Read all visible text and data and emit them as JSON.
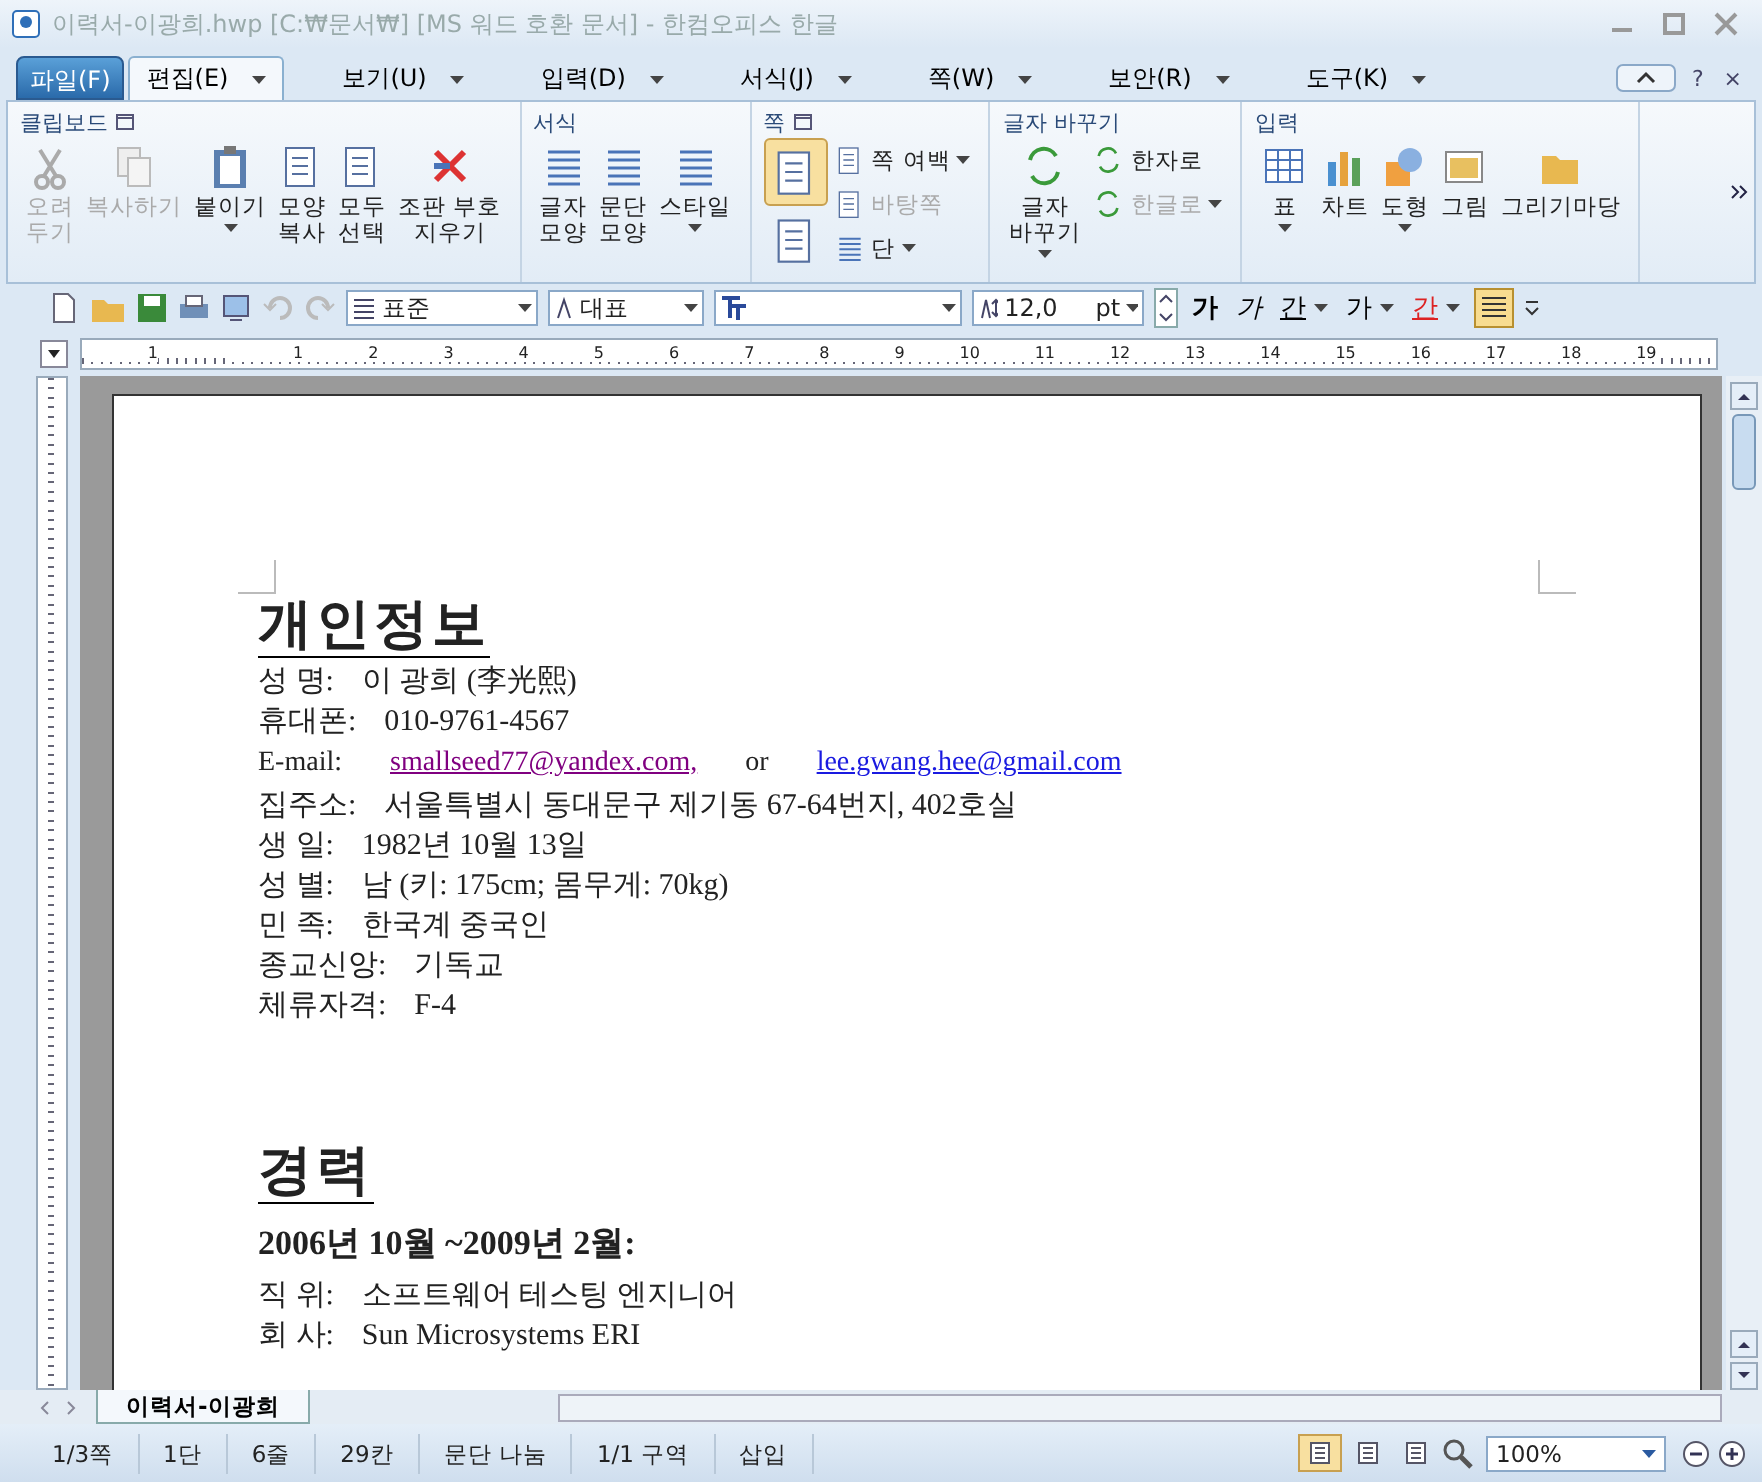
{
  "window": {
    "title": "이력서-이광희.hwp [C:₩문서₩] [MS 워드 호환 문서] - 한컴오피스 한글"
  },
  "menu_tabs": [
    {
      "label": "파일(F)",
      "kind": "file",
      "selected": false
    },
    {
      "label": "편집(E)",
      "kind": "tab",
      "selected": true,
      "dropdown": true
    },
    {
      "label": "보기(U)",
      "kind": "tab",
      "selected": false,
      "dropdown": true
    },
    {
      "label": "입력(D)",
      "kind": "tab",
      "selected": false,
      "dropdown": true
    },
    {
      "label": "서식(J)",
      "kind": "tab",
      "selected": false,
      "dropdown": true
    },
    {
      "label": "쪽(W)",
      "kind": "tab",
      "selected": false,
      "dropdown": true
    },
    {
      "label": "보안(R)",
      "kind": "tab",
      "selected": false,
      "dropdown": true
    },
    {
      "label": "도구(K)",
      "kind": "tab",
      "selected": false,
      "dropdown": true
    }
  ],
  "help_buttons": [
    "?",
    "×"
  ],
  "ribbon": [
    {
      "title": "클립보드",
      "settings": true,
      "items": [
        {
          "kind": "large",
          "label": "오려\n두기",
          "disabled": true,
          "dropdown": false
        },
        {
          "kind": "large",
          "label": "복사하기",
          "disabled": true,
          "dropdown": false
        },
        {
          "kind": "large",
          "label": "붙이기",
          "disabled": false,
          "dropdown": true
        },
        {
          "kind": "large",
          "label": "모양\n복사",
          "disabled": false,
          "dropdown": false
        },
        {
          "kind": "large",
          "label": "모두\n선택",
          "disabled": false,
          "dropdown": false
        },
        {
          "kind": "large",
          "label": "조판 부호\n지우기",
          "disabled": false,
          "dropdown": false
        }
      ]
    },
    {
      "title": "서식",
      "items": [
        {
          "kind": "large",
          "label": "글자\n모양",
          "disabled": false,
          "dropdown": false
        },
        {
          "kind": "large",
          "label": "문단\n모양",
          "disabled": false,
          "dropdown": false
        },
        {
          "kind": "large",
          "label": "스타일",
          "disabled": false,
          "dropdown": true
        }
      ]
    },
    {
      "title": "쪽",
      "settings": true,
      "items": [
        {
          "kind": "page",
          "selected": true
        },
        {
          "kind": "page",
          "selected": false
        },
        {
          "kind": "small",
          "label": "쪽 여백",
          "disabled": false,
          "dropdown": true
        },
        {
          "kind": "small",
          "label": "바탕쪽",
          "disabled": true,
          "dropdown": false
        },
        {
          "kind": "small",
          "label": "단",
          "disabled": false,
          "dropdown": true
        }
      ]
    },
    {
      "title": "글자 바꾸기",
      "items": [
        {
          "kind": "large",
          "label": "글자\n바꾸기",
          "disabled": false,
          "dropdown": true
        },
        {
          "kind": "small",
          "label": "한자로",
          "disabled": false,
          "dropdown": false
        },
        {
          "kind": "small",
          "label": "한글로",
          "disabled": true,
          "dropdown": true
        }
      ]
    },
    {
      "title": "입력",
      "items": [
        {
          "kind": "large",
          "label": "표",
          "disabled": false,
          "dropdown": true
        },
        {
          "kind": "large",
          "label": "차트",
          "disabled": false,
          "dropdown": false
        },
        {
          "kind": "large",
          "label": "도형",
          "disabled": false,
          "dropdown": true
        },
        {
          "kind": "large",
          "label": "그림",
          "disabled": false,
          "dropdown": false
        },
        {
          "kind": "large",
          "label": "그리기마당",
          "disabled": false,
          "dropdown": false
        }
      ]
    }
  ],
  "toolbar": {
    "style": "표준",
    "language": "대표",
    "size": "12,0",
    "unit": "pt",
    "format_buttons": [
      {
        "label": "가",
        "kind": "bold",
        "dropdown": false
      },
      {
        "label": "가",
        "kind": "italic",
        "dropdown": false
      },
      {
        "label": "간",
        "kind": "underline",
        "dropdown": true
      },
      {
        "label": "가",
        "kind": "outline",
        "dropdown": true
      },
      {
        "label": "간",
        "kind": "color",
        "dropdown": true
      }
    ]
  },
  "ruler": {
    "labels": [
      "1",
      "1",
      "2",
      "3",
      "4",
      "5",
      "6",
      "7",
      "8",
      "9",
      "10",
      "11",
      "12",
      "13",
      "14",
      "15",
      "16",
      "17",
      "18",
      "19"
    ]
  },
  "document": {
    "sections": [
      {
        "heading": "개인정보",
        "lines": [
          {
            "kind": "field",
            "label": "성 명:",
            "value": "이 광희 (李光熙)"
          },
          {
            "kind": "field",
            "label": "휴대폰:",
            "value": "010-9761-4567"
          },
          {
            "kind": "email",
            "label": "E-mail:",
            "links": [
              {
                "text": "smallseed77@yandex.com,",
                "visited": true
              },
              {
                "text": "lee.gwang.hee@gmail.com",
                "visited": false
              }
            ],
            "separator": "or"
          },
          {
            "kind": "field",
            "label": "집주소:",
            "value": "서울특별시 동대문구 제기동 67-64번지, 402호실"
          },
          {
            "kind": "field",
            "label": "생 일:",
            "value": "1982년 10월 13일"
          },
          {
            "kind": "field",
            "label": "성 별:",
            "value": "남 (키: 175cm; 몸무게: 70kg)"
          },
          {
            "kind": "field",
            "label": "민 족:",
            "value": "한국계 중국인"
          },
          {
            "kind": "field",
            "label": "종교신앙:",
            "value": "기독교"
          },
          {
            "kind": "field",
            "label": "체류자격:",
            "value": "F-4"
          }
        ]
      },
      {
        "heading": "경력",
        "lines": [
          {
            "kind": "period",
            "value": "2006년 10월 ~2009년 2월:"
          },
          {
            "kind": "field",
            "label": "직 위:",
            "value": "소프트웨어 테스팅 엔지니어"
          },
          {
            "kind": "field",
            "label": "회 사:",
            "value": "Sun Microsystems ERI"
          }
        ]
      }
    ]
  },
  "doc_tab": "이력서-이광희",
  "status_bar": {
    "items": [
      "1/3쪽",
      "1단",
      "6줄",
      "29칸",
      "문단 나눔",
      "1/1 구역",
      "삽입"
    ],
    "views": [
      {
        "selected": true
      },
      {
        "selected": false
      },
      {
        "selected": false
      }
    ],
    "zoom": "100%"
  }
}
